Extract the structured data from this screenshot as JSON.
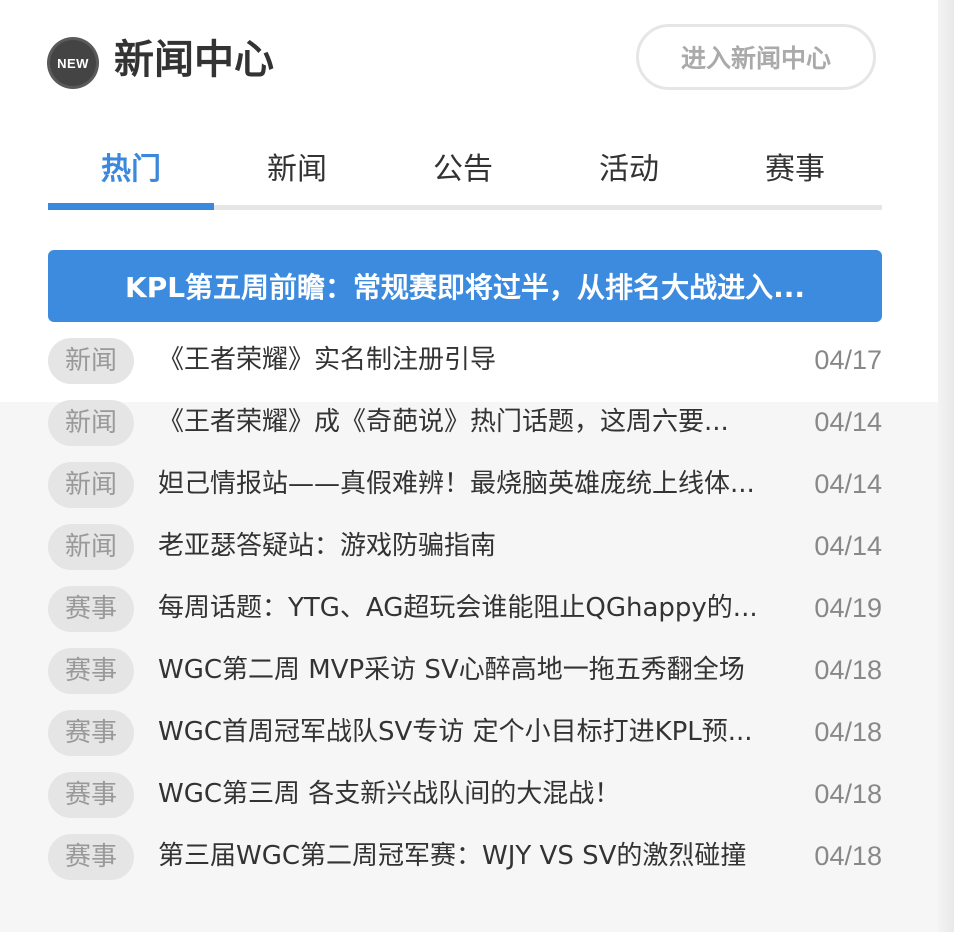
{
  "header": {
    "badge_text": "NEW",
    "title": "新闻中心",
    "enter_button": "进入新闻中心"
  },
  "tabs": [
    {
      "label": "热门",
      "active": true
    },
    {
      "label": "新闻",
      "active": false
    },
    {
      "label": "公告",
      "active": false
    },
    {
      "label": "活动",
      "active": false
    },
    {
      "label": "赛事",
      "active": false
    }
  ],
  "headline": {
    "text": "KPL第五周前瞻：常规赛即将过半，从排名大战进入..."
  },
  "news": [
    {
      "tag": "新闻",
      "title": "《王者荣耀》实名制注册引导",
      "date": "04/17"
    },
    {
      "tag": "新闻",
      "title": "《王者荣耀》成《奇葩说》热门话题，这周六要...",
      "date": "04/14"
    },
    {
      "tag": "新闻",
      "title": "妲己情报站——真假难辨！最烧脑英雄庞统上线体...",
      "date": "04/14"
    },
    {
      "tag": "新闻",
      "title": "老亚瑟答疑站：游戏防骗指南",
      "date": "04/14"
    },
    {
      "tag": "赛事",
      "title": "每周话题：YTG、AG超玩会谁能阻止QGhappy的...",
      "date": "04/19"
    },
    {
      "tag": "赛事",
      "title": "WGC第二周 MVP采访 SV心醉高地一拖五秀翻全场",
      "date": "04/18"
    },
    {
      "tag": "赛事",
      "title": "WGC首周冠军战队SV专访 定个小目标打进KPL预...",
      "date": "04/18"
    },
    {
      "tag": "赛事",
      "title": "WGC第三周 各支新兴战队间的大混战！",
      "date": "04/18"
    },
    {
      "tag": "赛事",
      "title": "第三届WGC第二周冠军赛：WJY VS SV的激烈碰撞",
      "date": "04/18"
    }
  ],
  "colors": {
    "accent": "#3b89dd",
    "headline_bg": "#3c8bdf",
    "tag_bg": "#e5e5e5",
    "tag_text": "#999999",
    "date_text": "#888888"
  }
}
